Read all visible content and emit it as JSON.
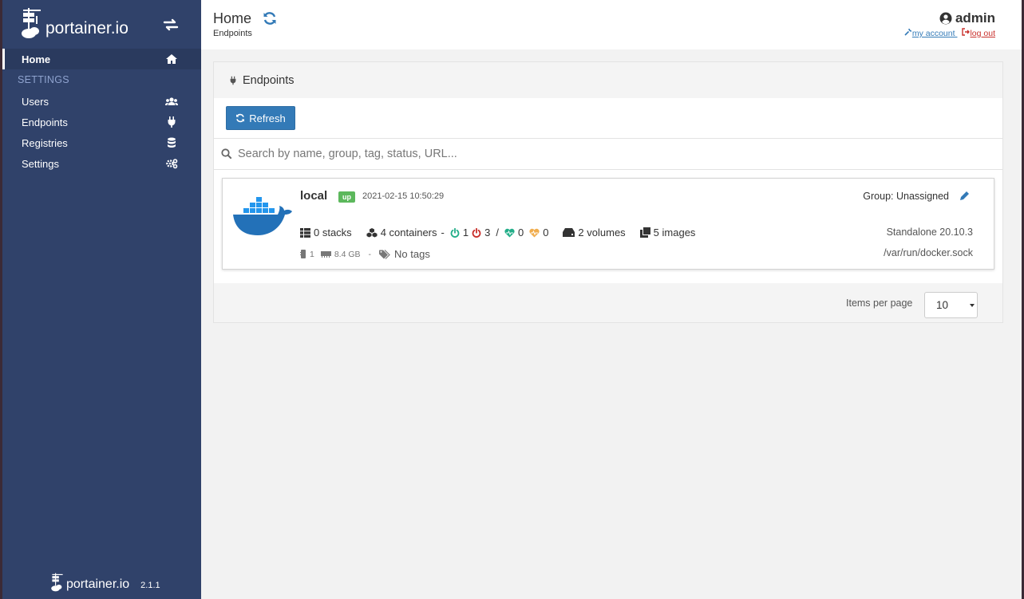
{
  "app": {
    "brand": "portainer.io",
    "version": "2.1.1"
  },
  "sidebar": {
    "home": "Home",
    "section": "SETTINGS",
    "items": [
      {
        "label": "Users",
        "icon": "users-icon"
      },
      {
        "label": "Endpoints",
        "icon": "plug-icon"
      },
      {
        "label": "Registries",
        "icon": "database-icon"
      },
      {
        "label": "Settings",
        "icon": "cogs-icon"
      }
    ]
  },
  "header": {
    "title": "Home",
    "breadcrumb": "Endpoints",
    "user": "admin",
    "my_account": "my account",
    "log_out": "log out"
  },
  "widget": {
    "title": "Endpoints",
    "refresh_label": "Refresh",
    "search_placeholder": "Search by name, group, tag, status, URL..."
  },
  "endpoint": {
    "name": "local",
    "status": "up",
    "timestamp": "2021-02-15 10:50:29",
    "group": "Group: Unassigned",
    "stacks": "0 stacks",
    "containers": "4 containers",
    "running": "1",
    "stopped": "3",
    "healthy": "0",
    "unhealthy": "0",
    "volumes": "2 volumes",
    "images": "5 images",
    "cpu": "1",
    "memory": "8.4 GB",
    "tags": "No tags",
    "type": "Standalone 20.10.3",
    "url": "/var/run/docker.sock"
  },
  "pagination": {
    "label": "Items per page",
    "value": "10"
  },
  "colors": {
    "sidebar": "#30426a",
    "primary": "#337ab7",
    "status_up": "#5cb85c",
    "running": "#23ae89",
    "stopped": "#c9302c",
    "healthy": "#23ae89",
    "unhealthy": "#f0ad4e"
  }
}
